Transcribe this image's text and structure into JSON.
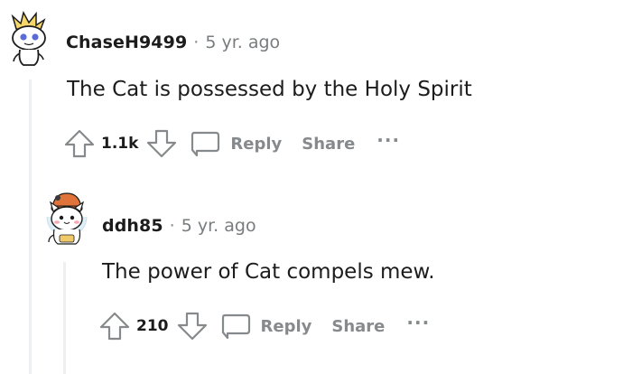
{
  "comments": [
    {
      "username": "ChaseH9499",
      "separator": "·",
      "time": "5 yr. ago",
      "body": "The Cat is possessed by the Holy Spirit",
      "votes": "1.1k",
      "reply_label": "Reply",
      "share_label": "Share",
      "more_label": "···",
      "avatar_icon": "snoo-avatar-icon"
    },
    {
      "username": "ddh85",
      "separator": "·",
      "time": "5 yr. ago",
      "body": "The power of Cat compels mew.",
      "votes": "210",
      "reply_label": "Reply",
      "share_label": "Share",
      "more_label": "···",
      "avatar_icon": "cat-avatar-icon"
    }
  ],
  "colors": {
    "text": "#1c1c1c",
    "muted": "#878a8c",
    "thread_line": "#edeff1"
  }
}
